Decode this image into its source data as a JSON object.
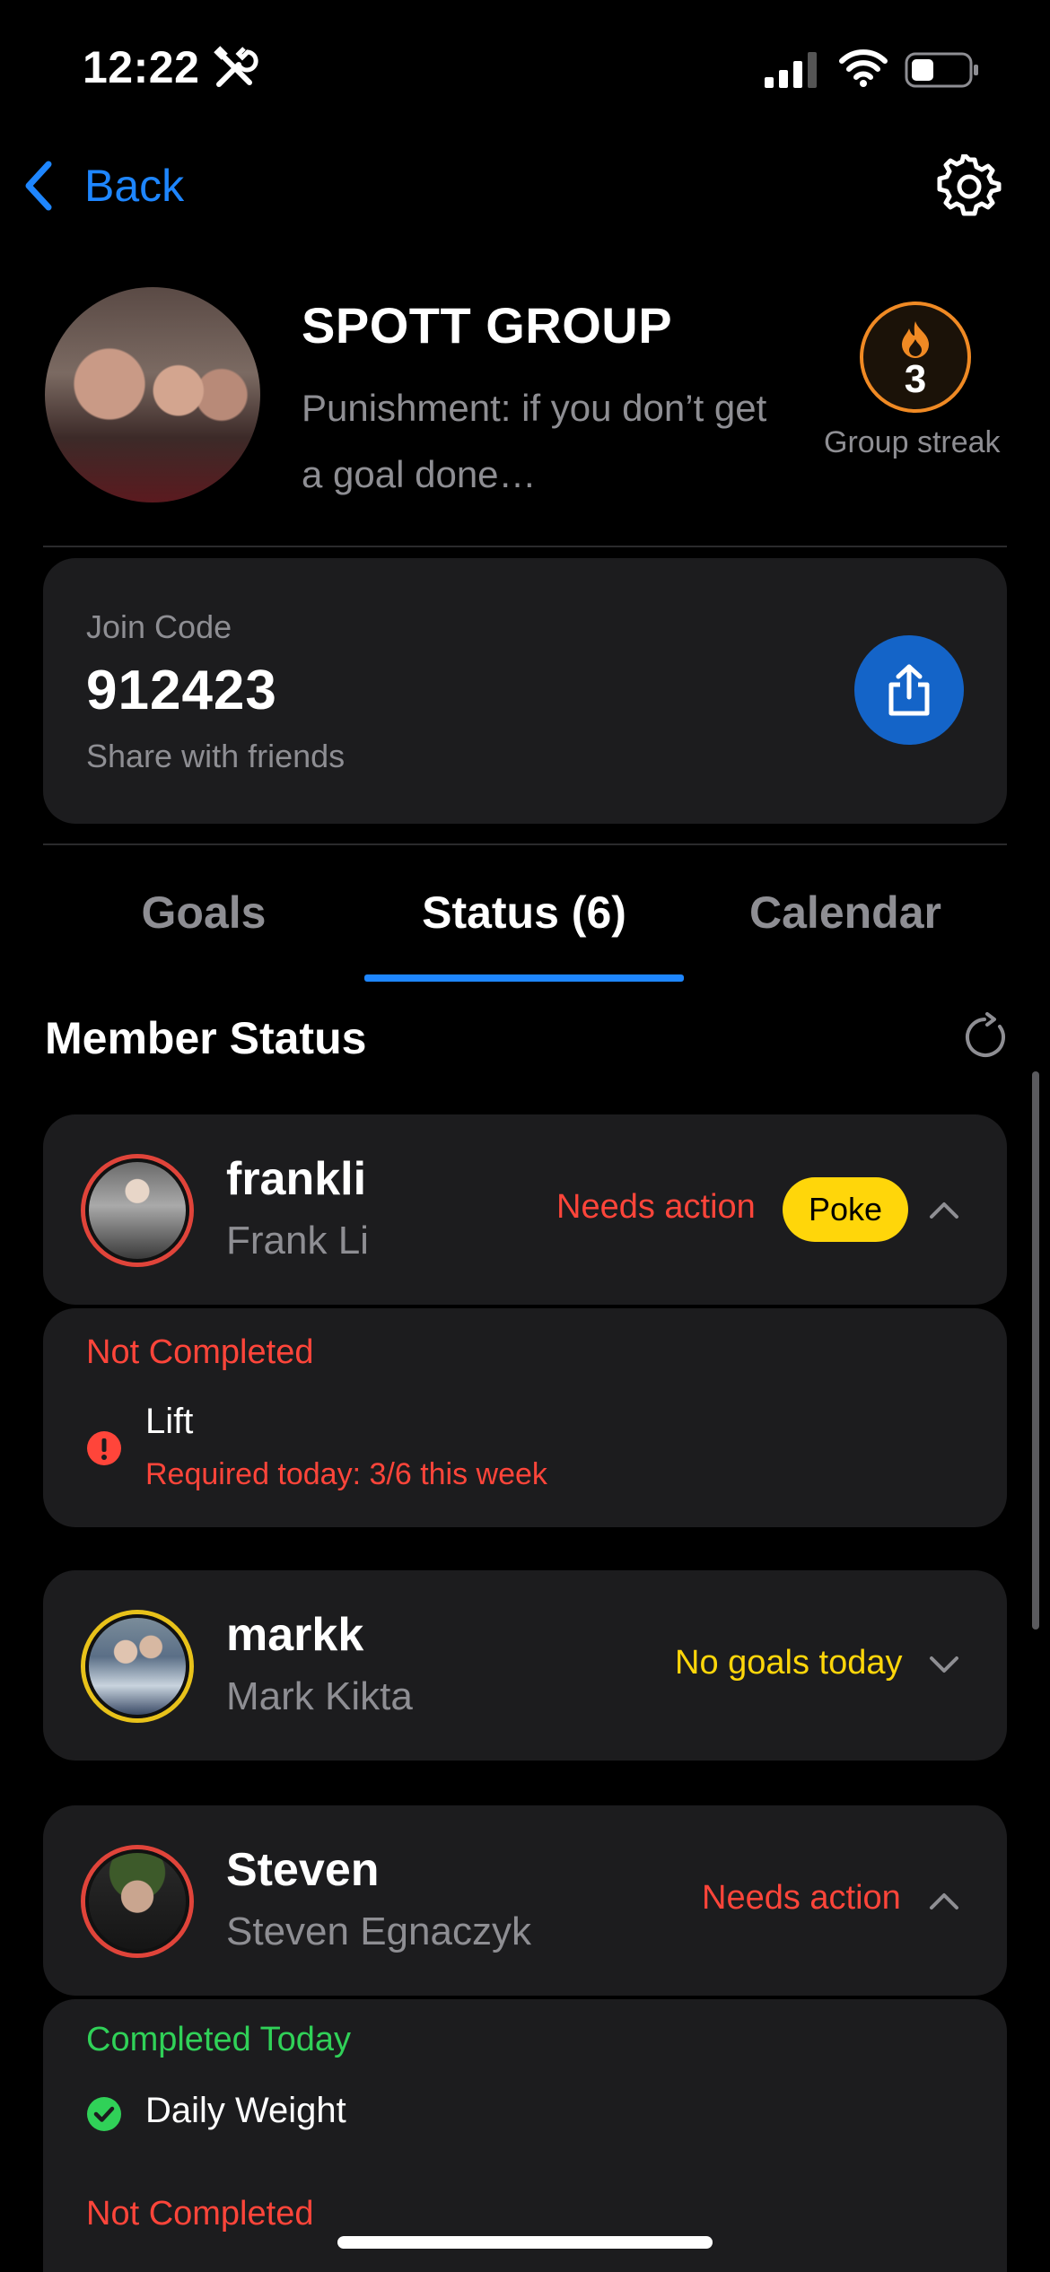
{
  "status_bar": {
    "time": "12:22"
  },
  "nav": {
    "back_label": "Back"
  },
  "group": {
    "name": "SPOTT GROUP",
    "description": "Punishment: if you don’t get a goal done…",
    "streak": "3",
    "streak_label": "Group streak"
  },
  "join": {
    "label": "Join Code",
    "code": "912423",
    "sub": "Share with friends"
  },
  "tabs": [
    {
      "label": "Goals"
    },
    {
      "label": "Status (6)"
    },
    {
      "label": "Calendar"
    }
  ],
  "section": {
    "title": "Member Status"
  },
  "members": [
    {
      "username": "frankli",
      "fullname": "Frank Li",
      "status": "Needs action",
      "poke_label": "Poke",
      "detail": {
        "heading": "Not Completed",
        "goal": "Lift",
        "goal_sub": "Required today: 3/6 this week"
      }
    },
    {
      "username": "markk",
      "fullname": "Mark Kikta",
      "status": "No goals today"
    },
    {
      "username": "Steven",
      "fullname": "Steven Egnaczyk",
      "status": "Needs action",
      "detail": {
        "completed_heading": "Completed Today",
        "completed_goal": "Daily Weight",
        "not_completed_heading": "Not Completed"
      }
    }
  ],
  "colors": {
    "accent": "#1e86ff",
    "danger": "#ff453a",
    "warning": "#ffd60a",
    "success": "#30d158",
    "streak": "#f08a24"
  }
}
